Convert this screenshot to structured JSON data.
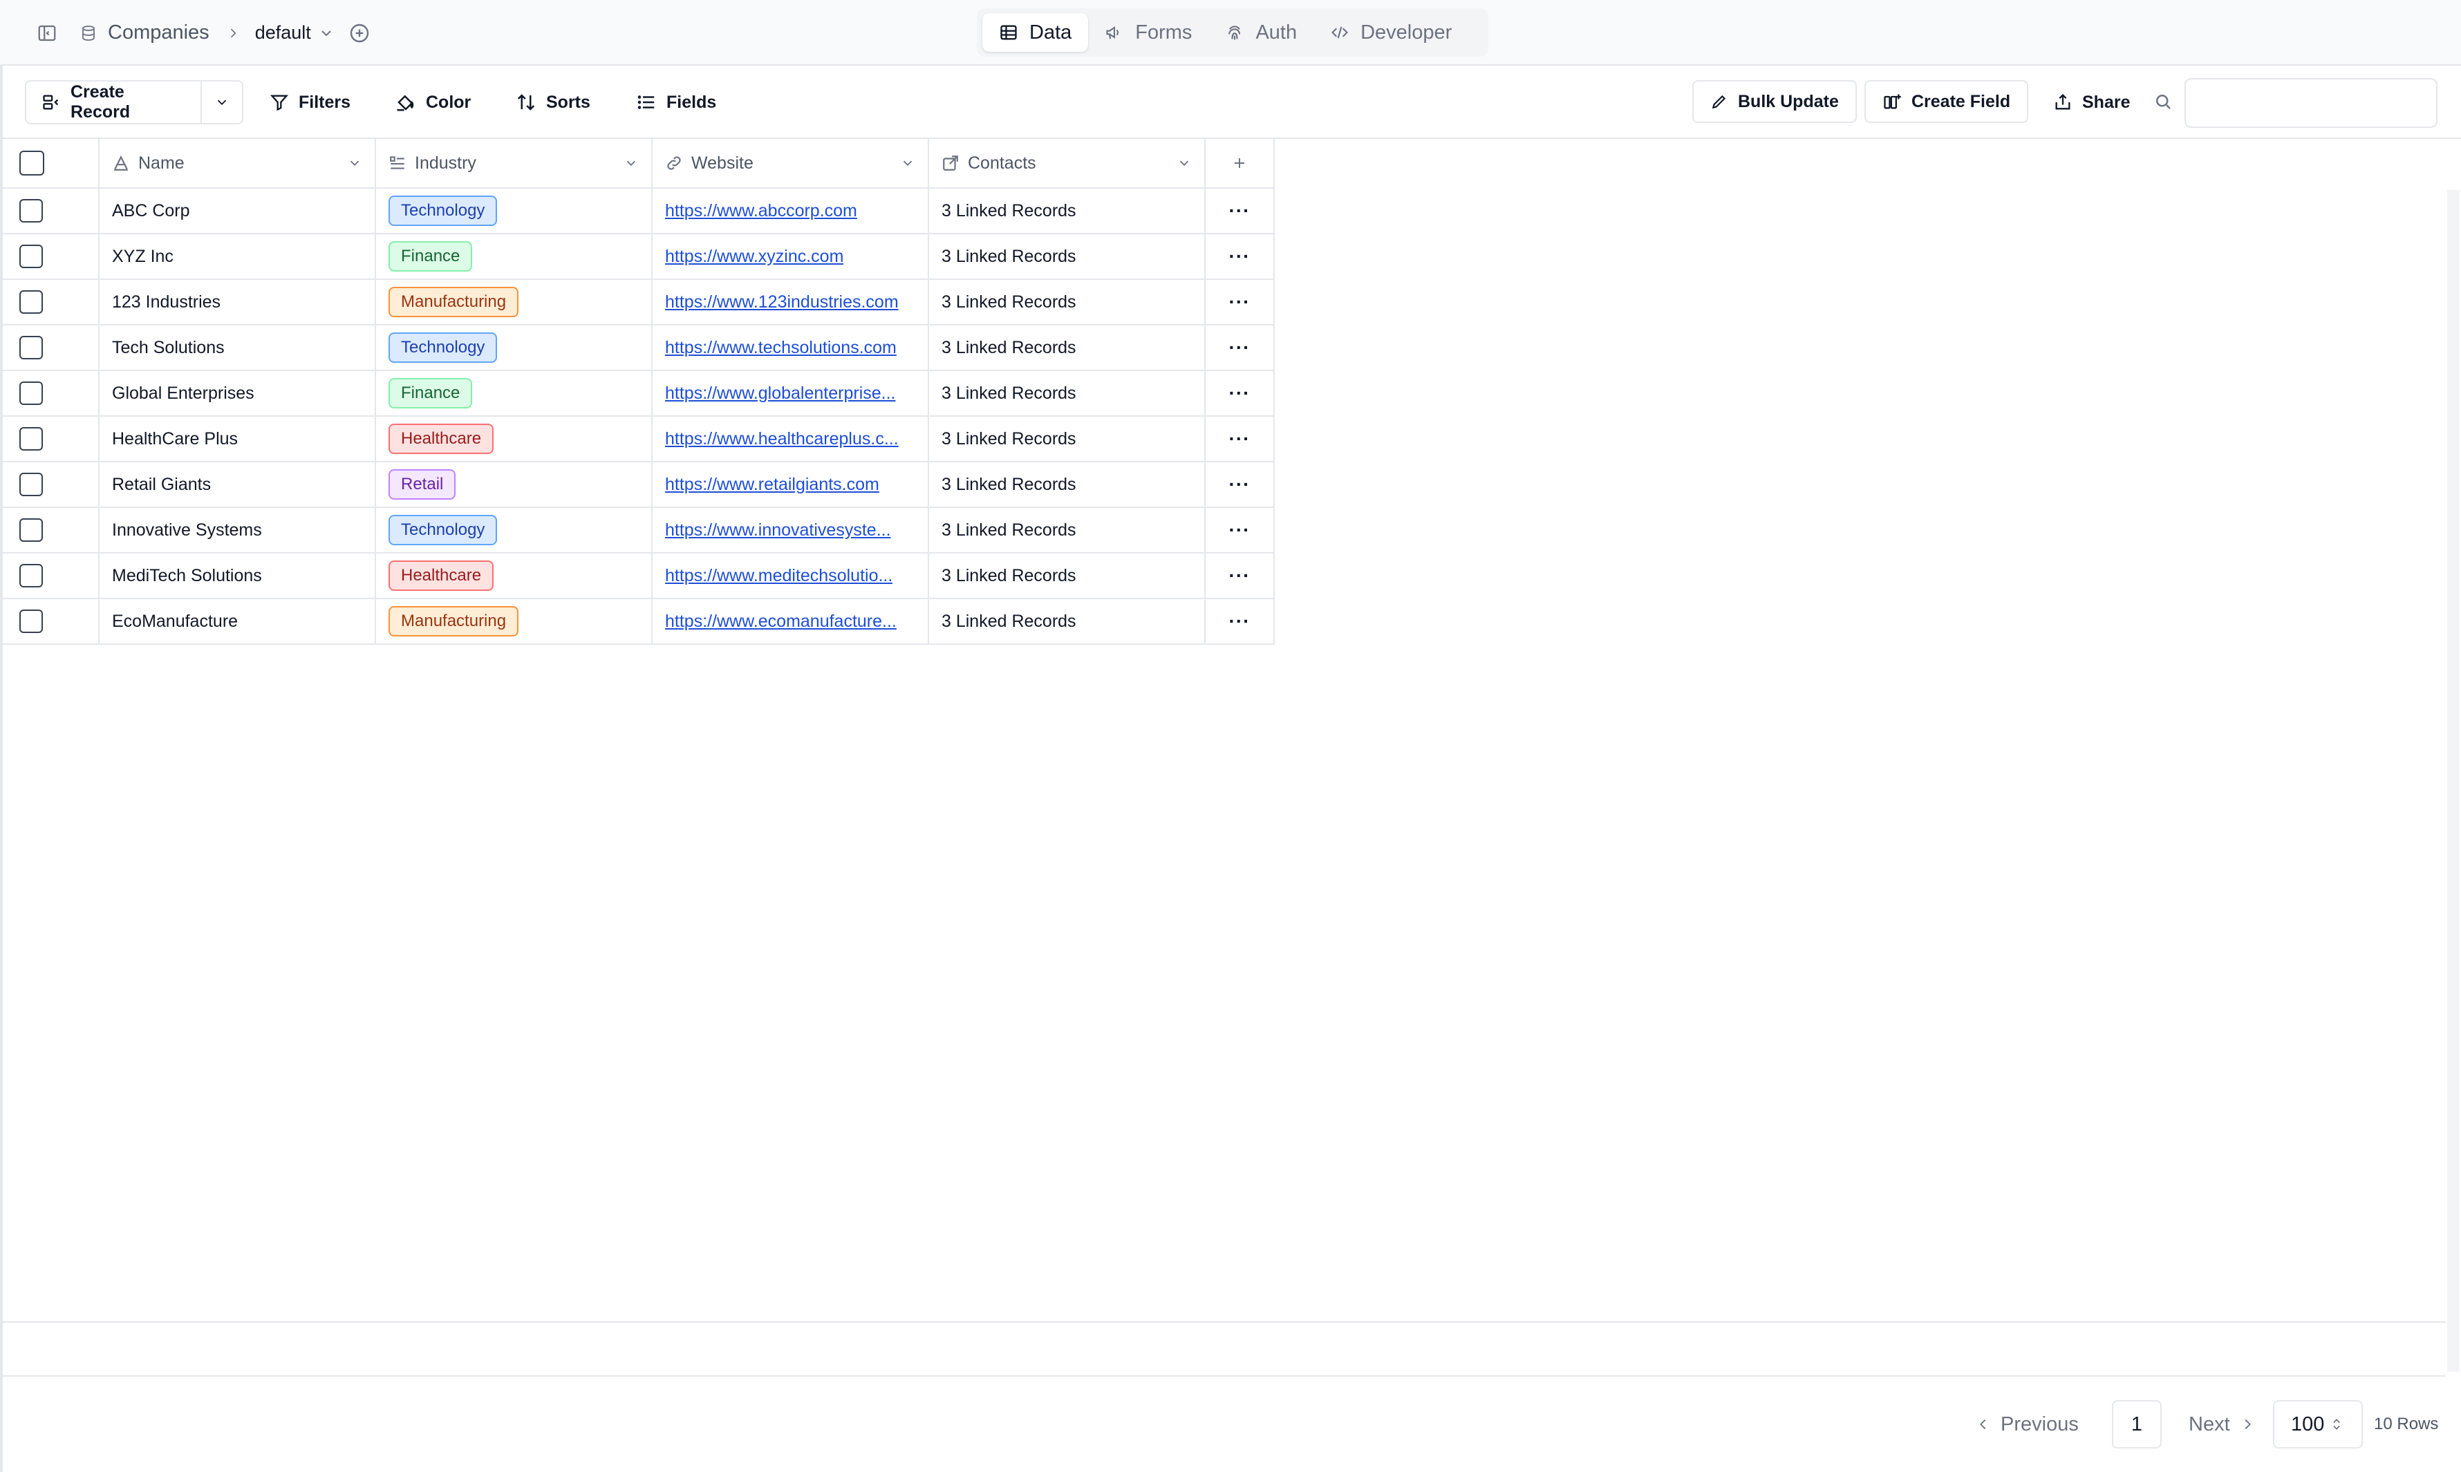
{
  "breadcrumb": {
    "table": "Companies",
    "view": "default"
  },
  "tabs": [
    {
      "label": "Data",
      "icon": "table-icon",
      "active": true
    },
    {
      "label": "Forms",
      "icon": "megaphone-icon",
      "active": false
    },
    {
      "label": "Auth",
      "icon": "fingerprint-icon",
      "active": false
    },
    {
      "label": "Developer",
      "icon": "code-icon",
      "active": false
    }
  ],
  "toolbar": {
    "create_record": "Create Record",
    "filters": "Filters",
    "color": "Color",
    "sorts": "Sorts",
    "fields": "Fields",
    "bulk_update": "Bulk Update",
    "create_field": "Create Field",
    "share": "Share",
    "search_value": ""
  },
  "columns": [
    {
      "label": "Name",
      "icon": "text-type-icon"
    },
    {
      "label": "Industry",
      "icon": "list-select-icon"
    },
    {
      "label": "Website",
      "icon": "link-icon"
    },
    {
      "label": "Contacts",
      "icon": "external-link-icon"
    }
  ],
  "rows": [
    {
      "name": "ABC Corp",
      "industry": "Technology",
      "website": "https://www.abccorp.com",
      "contacts": "3 Linked Records"
    },
    {
      "name": "XYZ Inc",
      "industry": "Finance",
      "website": "https://www.xyzinc.com",
      "contacts": "3 Linked Records"
    },
    {
      "name": "123 Industries",
      "industry": "Manufacturing",
      "website": "https://www.123industries.com",
      "contacts": "3 Linked Records"
    },
    {
      "name": "Tech Solutions",
      "industry": "Technology",
      "website": "https://www.techsolutions.com",
      "contacts": "3 Linked Records"
    },
    {
      "name": "Global Enterprises",
      "industry": "Finance",
      "website": "https://www.globalenterprise...",
      "contacts": "3 Linked Records"
    },
    {
      "name": "HealthCare Plus",
      "industry": "Healthcare",
      "website": "https://www.healthcareplus.c...",
      "contacts": "3 Linked Records"
    },
    {
      "name": "Retail Giants",
      "industry": "Retail",
      "website": "https://www.retailgiants.com",
      "contacts": "3 Linked Records"
    },
    {
      "name": "Innovative Systems",
      "industry": "Technology",
      "website": "https://www.innovativesyste...",
      "contacts": "3 Linked Records"
    },
    {
      "name": "MediTech Solutions",
      "industry": "Healthcare",
      "website": "https://www.meditechsolutio...",
      "contacts": "3 Linked Records"
    },
    {
      "name": "EcoManufacture",
      "industry": "Manufacturing",
      "website": "https://www.ecomanufacture...",
      "contacts": "3 Linked Records"
    }
  ],
  "industry_colors": {
    "Technology": {
      "bg": "#dbeafe",
      "border": "#60a5fa",
      "text": "#1e40af"
    },
    "Finance": {
      "bg": "#dcfce7",
      "border": "#86efac",
      "text": "#166534"
    },
    "Manufacturing": {
      "bg": "#ffedd5",
      "border": "#fb923c",
      "text": "#9a3412"
    },
    "Healthcare": {
      "bg": "#fee2e2",
      "border": "#f87171",
      "text": "#991b1b"
    },
    "Retail": {
      "bg": "#f3e8ff",
      "border": "#c084fc",
      "text": "#6b21a8"
    }
  },
  "pagination": {
    "previous": "Previous",
    "page": "1",
    "next": "Next",
    "page_size": "100",
    "rows_count": "10 Rows"
  }
}
